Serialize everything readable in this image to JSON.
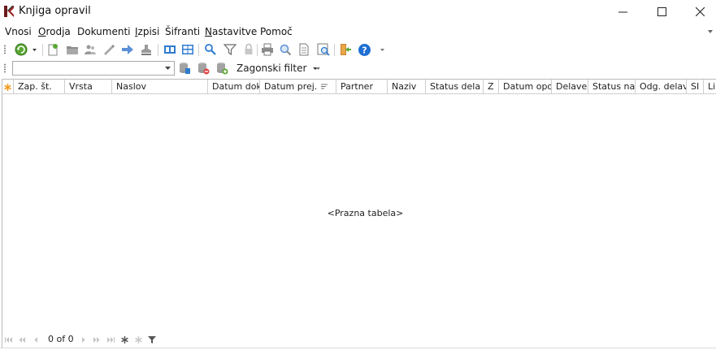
{
  "window": {
    "title": "Knjiga opravil"
  },
  "menu": [
    {
      "label": "Vnosi",
      "mnemonic": "",
      "rest": "Vnosi"
    },
    {
      "label": "Orodja",
      "mnemonic": "O",
      "rest": "rodja"
    },
    {
      "label": "Dokumenti",
      "mnemonic": "",
      "rest": "Dokumenti"
    },
    {
      "label": "Izpisi",
      "mnemonic": "I",
      "rest": "zpisi"
    },
    {
      "label": "Šifranti",
      "mnemonic": "",
      "rest": "Šifranti"
    },
    {
      "label": "Nastavitve",
      "mnemonic": "N",
      "rest": "astavitve"
    },
    {
      "label": "Pomoč",
      "mnemonic": "",
      "rest": "Pomoč"
    }
  ],
  "toolbar": {
    "filter_value": "",
    "boot_filter_label": "Zagonski filter"
  },
  "grid": {
    "columns": [
      "Zap. št.",
      "Vrsta",
      "Naslov",
      "Datum dok",
      "Datum prej.",
      "Partner",
      "Naziv",
      "Status dela",
      "Z",
      "Datum opo",
      "Delave",
      "Status na",
      "Odg. delav",
      "SI",
      "Lin"
    ],
    "empty_text": "<Prazna tabela>"
  },
  "navigator": {
    "record_count": "0 of 0"
  },
  "colors": {
    "accent_orange": "#f39a1e",
    "toolbar_blue": "#2e7bcf",
    "help_blue": "#1f6fd1",
    "green": "#5aa832",
    "border": "#bcbcbc"
  }
}
